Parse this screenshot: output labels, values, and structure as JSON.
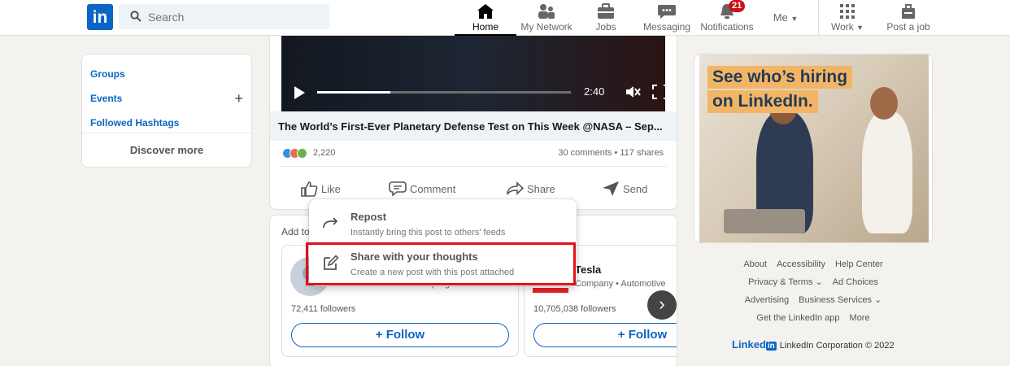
{
  "nav": {
    "logo": "in",
    "search_placeholder": "Search",
    "items": [
      {
        "label": "Home",
        "icon": "home-icon"
      },
      {
        "label": "My Network",
        "icon": "network-icon"
      },
      {
        "label": "Jobs",
        "icon": "briefcase-icon"
      },
      {
        "label": "Messaging",
        "icon": "chat-icon"
      },
      {
        "label": "Notifications",
        "icon": "bell-icon",
        "badge": "21"
      },
      {
        "label": "Me",
        "icon": "avatar"
      },
      {
        "label": "Work",
        "icon": "grid-icon"
      },
      {
        "label": "Post a job",
        "icon": "post-job-icon"
      }
    ]
  },
  "left": {
    "links": [
      "Groups",
      "Events",
      "Followed Hashtags"
    ],
    "discover": "Discover more"
  },
  "post": {
    "video_time": "2:40",
    "video_progress": 0.29,
    "title": "The World’s First-Ever Planetary Defense Test on This Week @NASA – Sep...",
    "reaction_count": "2,220",
    "stats": "30 comments • 117 shares",
    "actions": [
      "Like",
      "Comment",
      "Share",
      "Send"
    ]
  },
  "share_menu": {
    "items": [
      {
        "title": "Repost",
        "subtitle": "Instantly bring this post to others' feeds"
      },
      {
        "title": "Share with your thoughts",
        "subtitle": "Create a new post with this post attached"
      }
    ]
  },
  "suggestions": {
    "header": "Add to",
    "cards": [
      {
        "name": "",
        "desc": "Social Media Consultant | Digital...",
        "followers": "72,411 followers",
        "follow": "Follow"
      },
      {
        "name": "Tesla",
        "desc": "Company • Automotive",
        "followers": "10,705,038 followers",
        "follow": "Follow"
      }
    ]
  },
  "ad": {
    "line1": "See who’s hiring",
    "line2": "on LinkedIn."
  },
  "footer": {
    "rows": [
      [
        "About",
        "Accessibility",
        "Help Center"
      ],
      [
        "Privacy & Terms ⌄",
        "Ad Choices"
      ],
      [
        "Advertising",
        "Business Services ⌄"
      ],
      [
        "Get the LinkedIn app",
        "More"
      ]
    ],
    "brand": "Linked",
    "brand_in": "in",
    "copyright": "LinkedIn Corporation © 2022"
  },
  "colors": {
    "brand": "#0a66c2",
    "badge": "#cc1016",
    "highlight": "#e0101a",
    "ad_accent": "#f2b566"
  }
}
